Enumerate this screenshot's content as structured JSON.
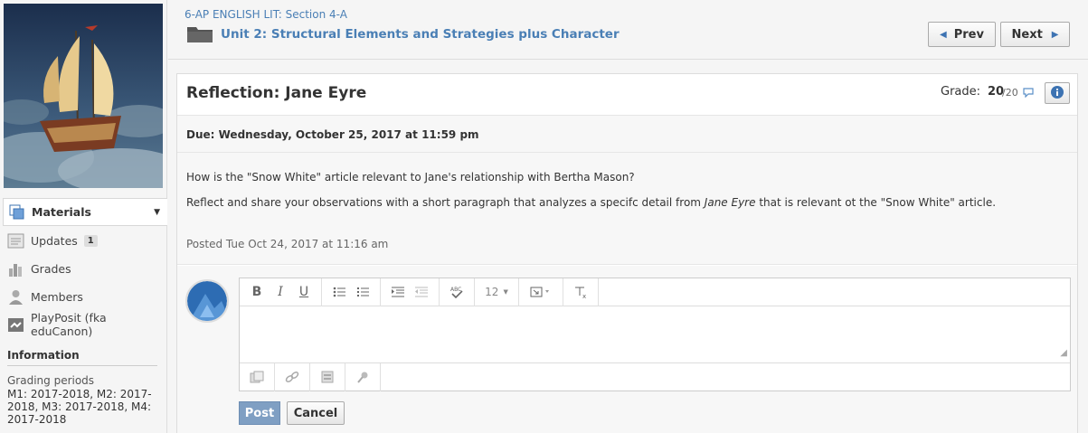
{
  "sidebar": {
    "materials_label": "Materials",
    "items": [
      {
        "label": "Updates",
        "badge": "1"
      },
      {
        "label": "Grades"
      },
      {
        "label": "Members"
      },
      {
        "label": "PlayPosit (fka eduCanon)"
      }
    ],
    "info_heading": "Information",
    "grading_label": "Grading periods",
    "grading_value": "M1: 2017-2018, M2: 2017-2018, M3: 2017-2018, M4: 2017-2018"
  },
  "header": {
    "breadcrumb": "6-AP ENGLISH LIT: Section 4-A",
    "unit_title": "Unit 2: Structural Elements and Strategies plus Character",
    "prev_label": "Prev",
    "next_label": "Next"
  },
  "assignment": {
    "title": "Reflection: Jane Eyre",
    "grade_label": "Grade:",
    "grade_value": "20",
    "grade_max": "/20",
    "due": "Due: Wednesday, October 25, 2017 at 11:59 pm",
    "question_1": "How is the \"Snow White\" article relevant to Jane's relationship with Bertha Mason?",
    "question_2_pre": "Reflect and share your observations with a short paragraph that analyzes a specifc detail from ",
    "question_2_em": "Jane Eyre",
    "question_2_post": " that is relevant ot the \"Snow White\" article.",
    "posted": "Posted Tue Oct 24, 2017 at 11:16 am"
  },
  "editor": {
    "font_size": "12",
    "post_label": "Post",
    "cancel_label": "Cancel"
  },
  "colors": {
    "link": "#4a7fb5",
    "post_button": "#7f9fc3",
    "accent_icon": "#3d73b2"
  }
}
